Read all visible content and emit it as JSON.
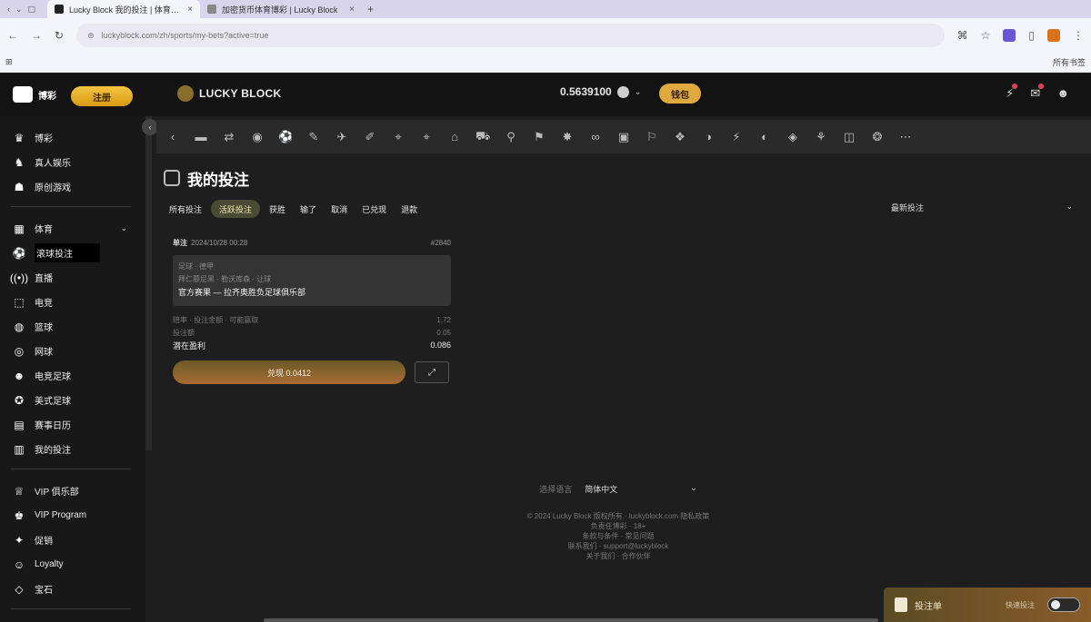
{
  "browser": {
    "tabs": [
      {
        "title": "Lucky Block 我的投注 | 体育博彩",
        "active": true
      },
      {
        "title": "加密货币体育博彩 | Lucky Block",
        "active": false
      }
    ],
    "url": "luckyblock.com/zh/sports/my-bets?active=true",
    "bookmarks_left": "⊞",
    "bookmarks_right": "所有书签"
  },
  "topnav": {
    "brand": "博彩",
    "promo_pill": "注册",
    "logo_text": "LUCKY BLOCK",
    "balance": "0.5639100",
    "deposit": "钱包"
  },
  "sidebar": {
    "group1": [
      {
        "icon": "casino-icon",
        "glyph": "♛",
        "label": "博彩"
      },
      {
        "icon": "live-casino-icon",
        "glyph": "♞",
        "label": "真人娱乐"
      },
      {
        "icon": "originals-icon",
        "glyph": "☗",
        "label": "原创游戏"
      }
    ],
    "group2": [
      {
        "icon": "sports-icon",
        "glyph": "▦",
        "label": "体育",
        "chevron": true
      },
      {
        "icon": "live-betting-icon",
        "glyph": "⚽",
        "label": "滚球投注",
        "highlight": true
      },
      {
        "icon": "live-icon",
        "glyph": "((•))",
        "label": "直播"
      },
      {
        "icon": "esports-icon",
        "glyph": "⬚",
        "label": "电竞"
      },
      {
        "icon": "basketball-icon",
        "glyph": "◍",
        "label": "篮球"
      },
      {
        "icon": "tennis-icon",
        "glyph": "◎",
        "label": "网球"
      },
      {
        "icon": "soccer-icon",
        "glyph": "☻",
        "label": "电竞足球"
      },
      {
        "icon": "american-football-icon",
        "glyph": "✪",
        "label": "美式足球"
      },
      {
        "icon": "schedule-icon",
        "glyph": "▤",
        "label": "赛事日历"
      },
      {
        "icon": "my-bets-icon",
        "glyph": "▥",
        "label": "我的投注"
      }
    ],
    "group3": [
      {
        "icon": "vip-icon",
        "glyph": "♕",
        "label": "VIP 俱乐部"
      },
      {
        "icon": "vip-program-icon",
        "glyph": "♚",
        "label": "VIP Program"
      },
      {
        "icon": "promotions-icon",
        "glyph": "✦",
        "label": "促销"
      },
      {
        "icon": "loyalty-icon",
        "glyph": "☺",
        "label": "Loyalty"
      },
      {
        "icon": "gems-icon",
        "glyph": "◇",
        "label": "宝石"
      }
    ]
  },
  "strip_icons": [
    "‹",
    "▬",
    "⇄",
    "◉",
    "⚽",
    "✎",
    "✈",
    "✐",
    "⌖",
    "⌖",
    "⌂",
    "⛟",
    "⚲",
    "⚑",
    "✸",
    "∞",
    "▣",
    "⚐",
    "❖",
    "◑",
    "⚡",
    "◐",
    "◈",
    "⚘",
    "◫",
    "❂",
    "⋯"
  ],
  "main": {
    "title": "我的投注",
    "filters": [
      {
        "label": "所有投注",
        "active": false
      },
      {
        "label": "活跃投注",
        "active": true
      },
      {
        "label": "获胜",
        "active": false
      },
      {
        "label": "输了",
        "active": false
      },
      {
        "label": "取消",
        "active": false
      },
      {
        "label": "已兑现",
        "active": false
      },
      {
        "label": "退款",
        "active": false
      }
    ],
    "sort_label": "最新投注",
    "bet": {
      "type": "单注",
      "date": "2024/10/28 00:28",
      "id": "#2840",
      "match_lines": [
        "足球 · 德甲",
        "拜仁慕尼黑 - 勒沃库森 · 让球"
      ],
      "selection": "官方赛果 — 拉齐奥胜负足球俱乐部",
      "rows": [
        {
          "label": "赔率 · 投注金额 · 可能赢取",
          "value": "1.72"
        },
        {
          "label": "投注额",
          "value": "0.05"
        },
        {
          "label": "潜在盈利",
          "value": "0.086",
          "strong": true
        }
      ],
      "cashout": "兑现 0.0412",
      "share": "⤢"
    }
  },
  "footer": {
    "lang_label": "选择语言",
    "lang_value": "简体中文",
    "lines": [
      "© 2024 Lucky Block 版权所有 · luckyblock.com 隐私政策",
      "负责任博彩 · 18+",
      "条款与条件 · 常见问题",
      "联系我们 · support@luckyblock",
      "关于我们 · 合作伙伴"
    ]
  },
  "betslip": {
    "label": "投注单",
    "toggle_label": "快速投注"
  }
}
